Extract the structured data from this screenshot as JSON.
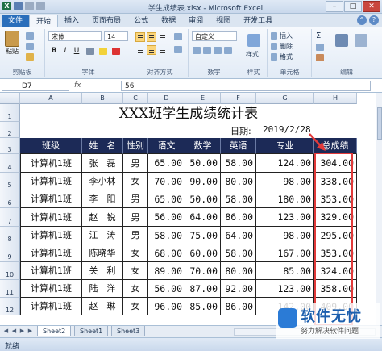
{
  "window": {
    "title": "学生成绩表.xlsx - Microsoft Excel",
    "min": "–",
    "max": "□",
    "close": "✕"
  },
  "ribbon": {
    "tabs": [
      "文件",
      "开始",
      "插入",
      "页面布局",
      "公式",
      "数据",
      "审阅",
      "视图",
      "开发工具"
    ],
    "paste_label": "粘贴",
    "font_name": "宋体",
    "font_size": "14",
    "bold": "B",
    "italic": "I",
    "underline": "U",
    "number_format": "自定义",
    "insert_label": "插入",
    "delete_label": "删除",
    "format_label": "格式",
    "groups": [
      "剪贴板",
      "字体",
      "对齐方式",
      "数字",
      "样式",
      "单元格",
      "编辑"
    ],
    "styles_label": "样式"
  },
  "formula_bar": {
    "name_box": "D7",
    "fx": "fx",
    "value": "56"
  },
  "sheet": {
    "columns": [
      "A",
      "B",
      "C",
      "D",
      "E",
      "F",
      "G",
      "H"
    ],
    "rows": [
      "1",
      "2",
      "3",
      "4",
      "5",
      "6",
      "7",
      "8",
      "9",
      "10",
      "11",
      "12"
    ],
    "title": "XXX班学生成绩统计表",
    "date_label": "日期:",
    "date_value": "2019/2/28",
    "headers": [
      "班级",
      "姓　名",
      "性别",
      "语文",
      "数学",
      "英语",
      "专业",
      "总成绩"
    ],
    "data": [
      [
        "计算机1班",
        "张　磊",
        "男",
        "65.00",
        "50.00",
        "58.00",
        "124.00",
        "304.00"
      ],
      [
        "计算机1班",
        "李小林",
        "女",
        "70.00",
        "90.00",
        "80.00",
        "98.00",
        "338.00"
      ],
      [
        "计算机1班",
        "李　阳",
        "男",
        "65.00",
        "50.00",
        "58.00",
        "180.00",
        "353.00"
      ],
      [
        "计算机1班",
        "赵　锐",
        "男",
        "56.00",
        "64.00",
        "86.00",
        "123.00",
        "329.00"
      ],
      [
        "计算机1班",
        "江　涛",
        "男",
        "58.00",
        "75.00",
        "64.00",
        "98.00",
        "295.00"
      ],
      [
        "计算机1班",
        "陈晓华",
        "女",
        "68.00",
        "60.00",
        "58.00",
        "167.00",
        "353.00"
      ],
      [
        "计算机1班",
        "关　利",
        "女",
        "89.00",
        "70.00",
        "80.00",
        "85.00",
        "324.00"
      ],
      [
        "计算机1班",
        "陆　洋",
        "女",
        "56.00",
        "87.00",
        "92.00",
        "123.00",
        "358.00"
      ],
      [
        "计算机1班",
        "赵　琳",
        "女",
        "96.00",
        "85.00",
        "86.00",
        "142.00",
        "409.00"
      ]
    ]
  },
  "sheet_tabs": [
    "Sheet2",
    "Sheet1",
    "Sheet3"
  ],
  "status": "就绪",
  "watermark": {
    "title": "软件无忧",
    "subtitle": "努力解决软件问题"
  },
  "colors": {
    "header_fill": "#1c2a57",
    "highlight": "#e23a3a",
    "file_tab": "#2a6ebb"
  }
}
